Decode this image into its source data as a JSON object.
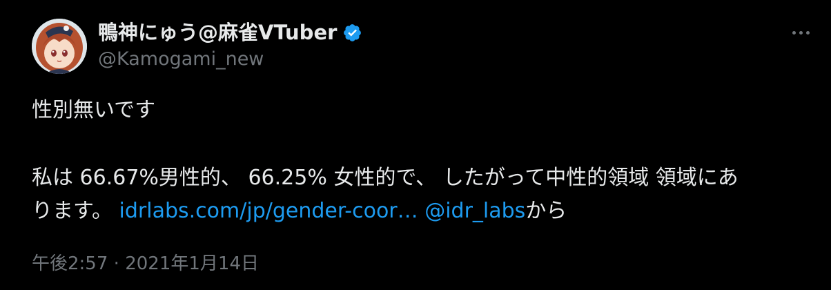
{
  "author": {
    "display_name": "鴨神にゅう@麻雀VTuber",
    "handle": "@Kamogami_new",
    "verified_icon": "verified-badge-icon",
    "accent_color": "#1d9bf0"
  },
  "tweet": {
    "line1": "性別無いです",
    "line2": "私は 66.67%男性的、 66.25% 女性的で、 したがって中性的領域 領域にあ",
    "line3_prefix": "ります。 ",
    "link_url": "idrlabs.com/jp/gender-coor…",
    "mention": "@idr_labs",
    "line3_suffix": "から"
  },
  "meta": {
    "time": "午後2:57",
    "separator": "·",
    "date": "2021年1月14日"
  },
  "menu": {
    "icon": "more-options-icon"
  }
}
